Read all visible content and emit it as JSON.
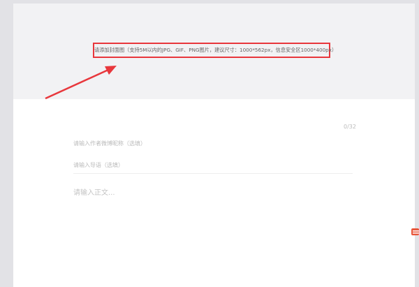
{
  "cover": {
    "hint": "请添加封面图（支持5M以内的JPG、GIF、PNG图片，建议尺寸：1000*562px，信息安全区1000*400px）"
  },
  "title": {
    "counter": "0/32"
  },
  "fields": {
    "author_placeholder": "请输入作者微博昵称（选填）",
    "intro_placeholder": "请输入导语（选填）",
    "body_placeholder": "请输入正文..."
  },
  "colors": {
    "annotation": "#e8373c",
    "cover_bg": "#f2f2f4"
  }
}
